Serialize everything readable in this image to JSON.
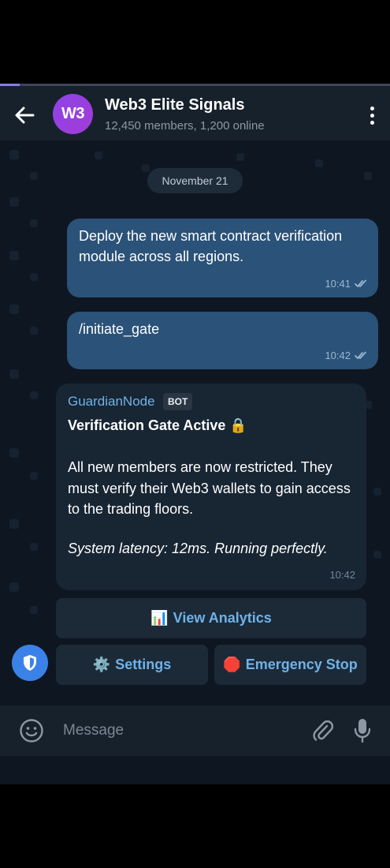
{
  "header": {
    "avatar_initials": "W3",
    "title": "Web3 Elite Signals",
    "subtitle": "12,450 members, 1,200 online",
    "progress": 0.05
  },
  "chat": {
    "date_label": "November 21",
    "messages": [
      {
        "text": "Deploy the new smart contract verification module across all regions.",
        "time": "10:41",
        "status": "read"
      },
      {
        "text": "/initiate_gate",
        "time": "10:42",
        "status": "read"
      }
    ],
    "bot_message": {
      "sender": "GuardianNode",
      "badge": "BOT",
      "title": "Verification Gate Active 🔒",
      "body": "All new members are now restricted. They must verify their Web3 wallets to gain access to the trading floors.",
      "footer": "System latency: 12ms. Running perfectly.",
      "time": "10:42"
    },
    "keyboard": {
      "analytics": {
        "icon": "📊",
        "label": "View Analytics"
      },
      "settings": {
        "icon": "⚙️",
        "label": "Settings"
      },
      "emergency": {
        "icon": "🛑",
        "label": "Emergency Stop"
      }
    }
  },
  "composer": {
    "placeholder": "Message"
  },
  "colors": {
    "accent": "#6fb2e8",
    "outgoing_bubble": "#2b5278",
    "incoming_bubble": "#182533",
    "background": "#0e1621",
    "avatar": "#8e44e8"
  }
}
